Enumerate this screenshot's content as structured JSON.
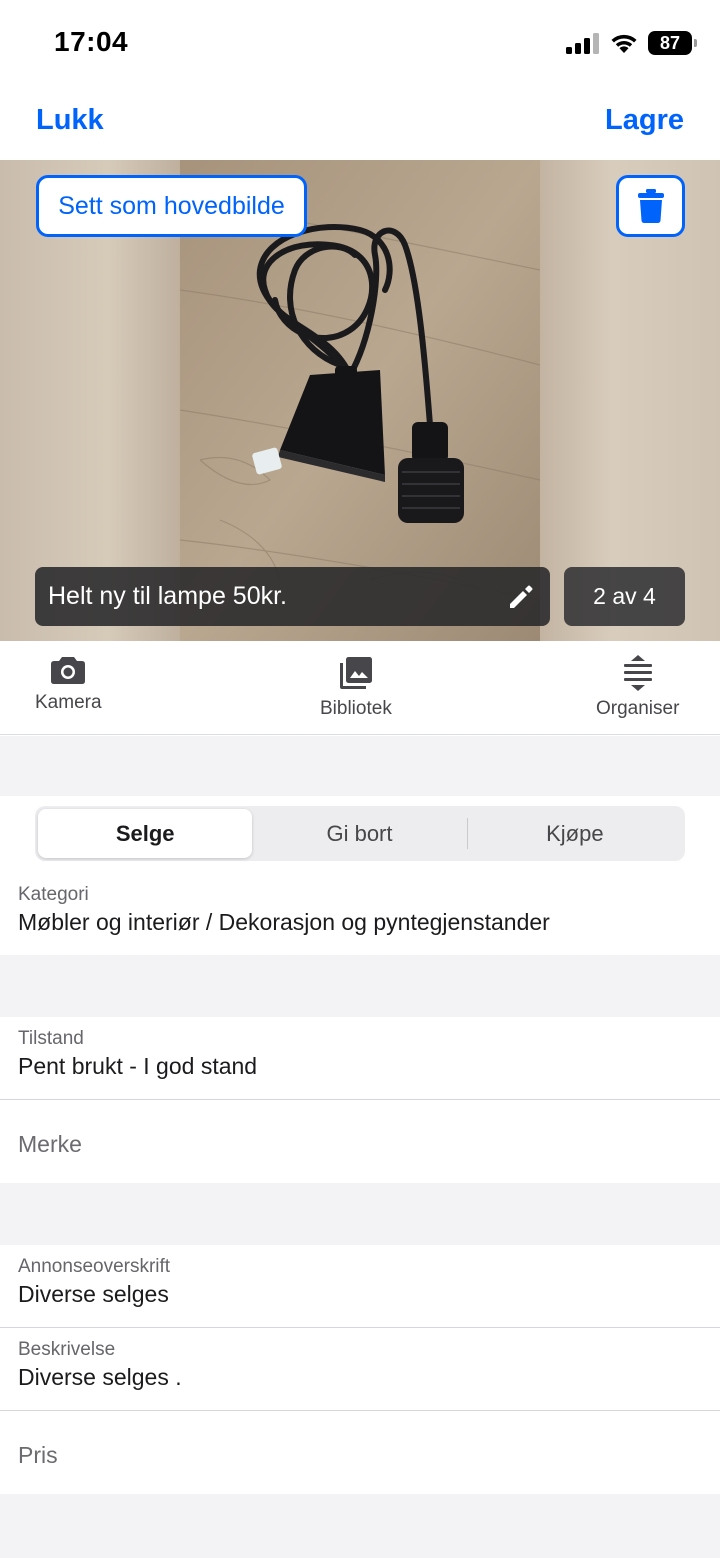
{
  "status_bar": {
    "time": "17:04",
    "battery": "87"
  },
  "nav": {
    "close_label": "Lukk",
    "save_label": "Lagre"
  },
  "photo": {
    "set_main_label": "Sett som hovedbilde",
    "caption": "Helt ny til lampe 50kr.",
    "counter": "2 av 4"
  },
  "toolbar": {
    "camera_label": "Kamera",
    "library_label": "Bibliotek",
    "organize_label": "Organiser"
  },
  "segments": {
    "items": [
      "Selge",
      "Gi bort",
      "Kjøpe"
    ],
    "selected": "Selge"
  },
  "fields": {
    "category": {
      "label": "Kategori",
      "value": "Møbler og interiør / Dekorasjon og pyntegjenstander"
    },
    "condition": {
      "label": "Tilstand",
      "value": "Pent brukt - I god stand"
    },
    "brand": {
      "placeholder": "Merke"
    },
    "title": {
      "label": "Annonseoverskrift",
      "value": "Diverse selges"
    },
    "description": {
      "label": "Beskrivelse",
      "value": "Diverse selges ."
    },
    "price": {
      "placeholder": "Pris"
    }
  },
  "colors": {
    "accent": "#0063fb",
    "section_background": "#f3f3f6",
    "text": "#1b1b1d"
  },
  "icons": [
    "signal-icon",
    "wifi-icon",
    "battery-icon",
    "trash-icon",
    "pencil-icon",
    "camera-icon",
    "photo-library-icon",
    "organize-icon"
  ]
}
